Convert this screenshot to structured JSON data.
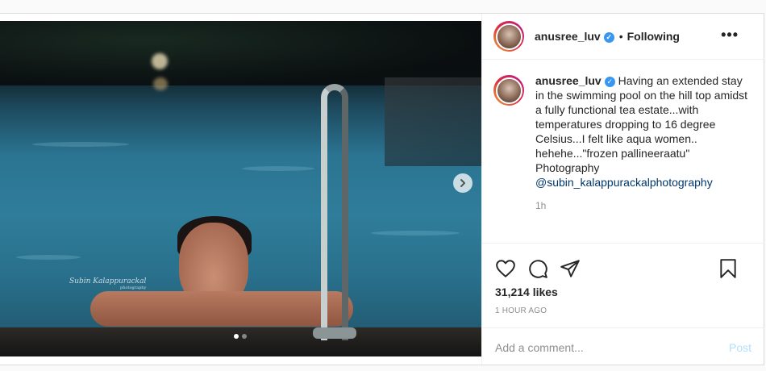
{
  "header": {
    "username": "anusree_luv",
    "verified_mark": "✓",
    "separator": "•",
    "follow_status": "Following",
    "more_label": "•••"
  },
  "media": {
    "watermark_main": "Subin Kalappurackal",
    "watermark_sub": "photography",
    "carousel_icon": "chevron-right-icon",
    "carousel_count": 2,
    "carousel_active_index": 0
  },
  "caption": {
    "username": "anusree_luv",
    "verified_mark": "✓",
    "text": "Having an extended stay in the swimming pool on the hill top amidst a fully functional tea estate...with temperatures dropping to 16 degree Celsius...I felt like aqua women.. hehehe...\"frozen pallineeraatu\"\nPhotography",
    "mention": "@subin_kalappurackalphotography",
    "time_ago": "1h"
  },
  "actions": {
    "icons": [
      "heart-icon",
      "comment-icon",
      "share-icon",
      "bookmark-icon"
    ],
    "likes": "31,214 likes",
    "post_time": "1 HOUR AGO"
  },
  "comment": {
    "placeholder": "Add a comment...",
    "post_label": "Post"
  },
  "colors": {
    "accent": "#3897f0",
    "mention": "#00376b",
    "post_disabled": "#b2dffc",
    "muted": "#8e8e8e"
  }
}
